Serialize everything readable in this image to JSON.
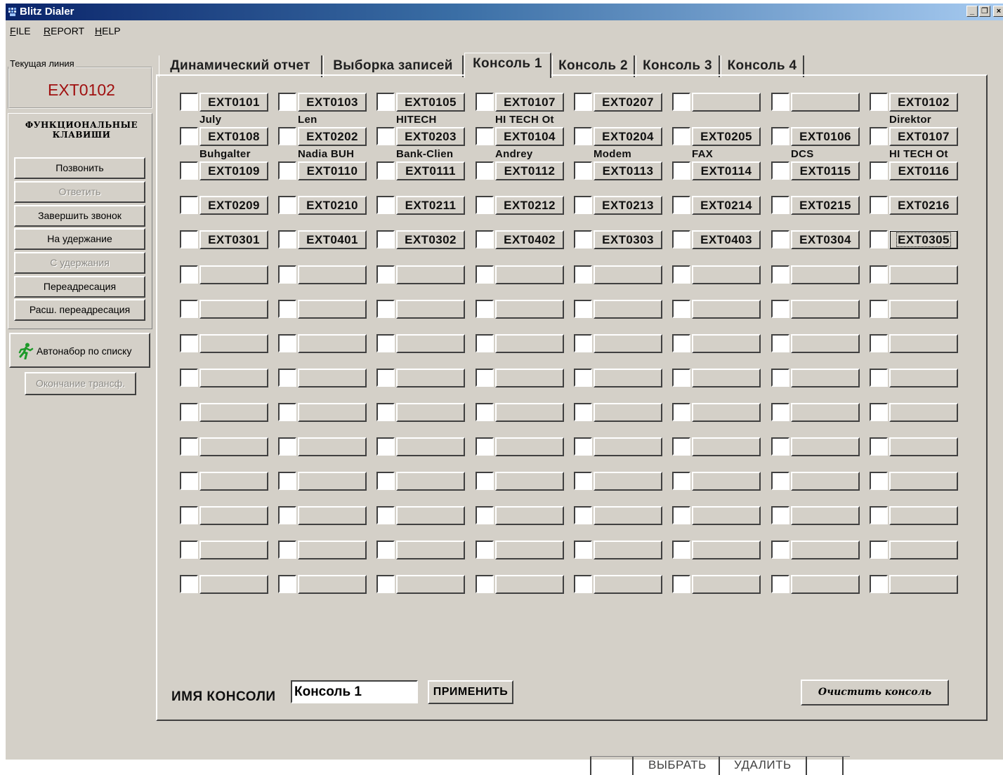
{
  "window": {
    "title": "Blitz Dialer",
    "controls": [
      "_",
      "❐",
      "×"
    ]
  },
  "menu": [
    {
      "label": "FILE"
    },
    {
      "label": "REPORT"
    },
    {
      "label": "HELP"
    }
  ],
  "left": {
    "current_line_caption": "Текущая линия",
    "current_line_value": "EXT0102",
    "function_keys_title_1": "ФУНКЦИОНАЛЬНЫЕ",
    "function_keys_title_2": "КЛАВИШИ",
    "buttons": [
      {
        "label": "Позвонить",
        "enabled": true
      },
      {
        "label": "Ответить",
        "enabled": false
      },
      {
        "label": "Завершить звонок",
        "enabled": true
      },
      {
        "label": "На удержание",
        "enabled": true
      },
      {
        "label": "С удержания",
        "enabled": false
      },
      {
        "label": "Переадресация",
        "enabled": true
      },
      {
        "label": "Расш. переадресация",
        "enabled": true
      }
    ],
    "autodial_label": "Автонабор по списку",
    "autodial_icon": "running-man-icon",
    "transfer_end_label": "Окончание трансф."
  },
  "tabs": [
    {
      "label": "Динамический отчет",
      "active": false
    },
    {
      "label": "Выборка записей",
      "active": false
    },
    {
      "label": "Консоль 1",
      "active": true
    },
    {
      "label": "Консоль 2",
      "active": false
    },
    {
      "label": "Консоль 3",
      "active": false
    },
    {
      "label": "Консоль 4",
      "active": false
    }
  ],
  "console": {
    "rows": [
      [
        "EXT0101",
        "EXT0103",
        "EXT0105",
        "EXT0107",
        "EXT0207",
        "",
        "",
        "EXT0102"
      ],
      [
        "EXT0108",
        "EXT0202",
        "EXT0203",
        "EXT0104",
        "EXT0204",
        "EXT0205",
        "EXT0106",
        "EXT0107"
      ],
      [
        "EXT0109",
        "EXT0110",
        "EXT0111",
        "EXT0112",
        "EXT0113",
        "EXT0114",
        "EXT0115",
        "EXT0116"
      ],
      [
        "EXT0209",
        "EXT0210",
        "EXT0211",
        "EXT0212",
        "EXT0213",
        "EXT0214",
        "EXT0215",
        "EXT0216"
      ],
      [
        "EXT0301",
        "EXT0401",
        "EXT0302",
        "EXT0402",
        "EXT0303",
        "EXT0403",
        "EXT0304",
        "EXT0305"
      ],
      [
        "",
        "",
        "",
        "",
        "",
        "",
        "",
        ""
      ],
      [
        "",
        "",
        "",
        "",
        "",
        "",
        "",
        ""
      ],
      [
        "",
        "",
        "",
        "",
        "",
        "",
        "",
        ""
      ],
      [
        "",
        "",
        "",
        "",
        "",
        "",
        "",
        ""
      ],
      [
        "",
        "",
        "",
        "",
        "",
        "",
        "",
        ""
      ],
      [
        "",
        "",
        "",
        "",
        "",
        "",
        "",
        ""
      ],
      [
        "",
        "",
        "",
        "",
        "",
        "",
        "",
        ""
      ],
      [
        "",
        "",
        "",
        "",
        "",
        "",
        "",
        ""
      ],
      [
        "",
        "",
        "",
        "",
        "",
        "",
        "",
        ""
      ],
      [
        "",
        "",
        "",
        "",
        "",
        "",
        "",
        ""
      ]
    ],
    "name_rows": [
      [
        "July",
        "Len",
        "HITECH",
        "HI TECH Ot",
        "",
        "",
        "",
        "Direktor"
      ],
      [
        "Buhgalter",
        "Nadia BUH",
        "Bank-Clien",
        "Andrey",
        "Modem",
        "FAX",
        "DCS",
        "HI TECH Ot"
      ]
    ],
    "focused_button": "EXT0305",
    "name_label": "ИМЯ КОНСОЛИ",
    "name_value": "Консоль 1",
    "apply_label": "ПРИМЕНИТЬ",
    "clear_label": "Очистить консоль"
  },
  "bottom": {
    "select_label": "ВЫБРАТЬ",
    "delete_label": "УДАЛИТЬ"
  }
}
